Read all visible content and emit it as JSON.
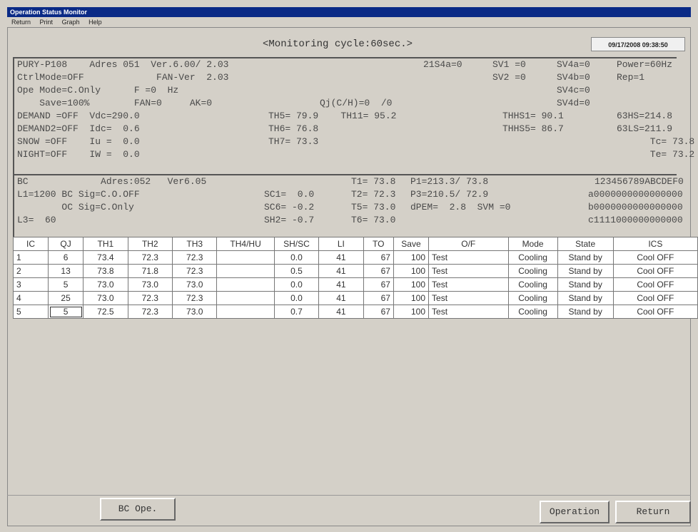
{
  "window": {
    "title": "Operation Status Monitor"
  },
  "menu": [
    "Return",
    "Print",
    "Graph",
    "Help"
  ],
  "header": {
    "cycle": "<Monitoring cycle:60sec.>",
    "datetime": "09/17/2008 09:38:50"
  },
  "outdoor": {
    "lines": [
      "PURY-P108    Adres 051  Ver.6.00/ 2.03",
      "CtrlMode=OFF             FAN-Ver  2.03",
      "Ope Mode=C.Only      F =0  Hz",
      "    Save=100%        FAN=0     AK=0",
      "DEMAND =OFF  Vdc=290.0",
      "DEMAND2=OFF  Idc=  0.6",
      "SNOW =OFF    Iu =  0.0",
      "NIGHT=OFF    IW =  0.0"
    ],
    "mid": [
      "",
      "",
      "",
      "Qj(C/H)=0  /0",
      "TH5= 79.9    TH11= 95.2",
      "TH6= 76.8",
      "TH7= 73.3",
      ""
    ],
    "right1": [
      "21S4a=0",
      "",
      "",
      "",
      "",
      "",
      "",
      ""
    ],
    "right2": [
      "SV1 =0",
      "SV2 =0",
      "",
      "",
      "THHS1= 90.1",
      "THHS5= 86.7",
      "",
      ""
    ],
    "right3": [
      "SV4a=0",
      "SV4b=0",
      "SV4c=0",
      "SV4d=0",
      "",
      "",
      "",
      ""
    ],
    "right4": [
      "Power=60Hz",
      "Rep=1",
      "",
      "",
      "63HS=214.8",
      "63LS=211.9",
      "      Tc= 73.8",
      "      Te= 73.2"
    ]
  },
  "bc": {
    "lines": [
      "BC             Adres:052   Ver6.05",
      "L1=1200 BC Sig=C.O.OFF",
      "        OC Sig=C.Only",
      "L3=  60"
    ],
    "sc": [
      "",
      "SC1=  0.0",
      "SC6= -0.2",
      "SH2= -0.7"
    ],
    "t": [
      "T1= 73.8",
      "T2= 72.3",
      "T5= 73.0",
      "T6= 73.0"
    ],
    "p": [
      "P1=213.3/ 73.8",
      "P3=210.5/ 72.9",
      "dPEM=  2.8  SVM =0",
      ""
    ],
    "hex": [
      "123456789ABCDEF0",
      "a0000000000000000",
      "b0000000000000000",
      "c1111000000000000"
    ]
  },
  "table": {
    "headers": [
      "IC",
      "QJ",
      "TH1",
      "TH2",
      "TH3",
      "TH4/HU",
      "SH/SC",
      "LI",
      "TO",
      "Save",
      "O/F",
      "Mode",
      "State",
      "ICS"
    ],
    "rows": [
      [
        "1",
        "6",
        "73.4",
        "72.3",
        "72.3",
        "",
        "0.0",
        "41",
        "67",
        "100",
        "Test",
        "Cooling",
        "Stand by",
        "Cool OFF"
      ],
      [
        "2",
        "13",
        "73.8",
        "71.8",
        "72.3",
        "",
        "0.5",
        "41",
        "67",
        "100",
        "Test",
        "Cooling",
        "Stand by",
        "Cool OFF"
      ],
      [
        "3",
        "5",
        "73.0",
        "73.0",
        "73.0",
        "",
        "0.0",
        "41",
        "67",
        "100",
        "Test",
        "Cooling",
        "Stand by",
        "Cool OFF"
      ],
      [
        "4",
        "25",
        "73.0",
        "72.3",
        "72.3",
        "",
        "0.0",
        "41",
        "67",
        "100",
        "Test",
        "Cooling",
        "Stand by",
        "Cool OFF"
      ],
      [
        "5",
        "5",
        "72.5",
        "72.3",
        "73.0",
        "",
        "0.7",
        "41",
        "67",
        "100",
        "Test",
        "Cooling",
        "Stand by",
        "Cool OFF"
      ]
    ]
  },
  "buttons": {
    "bc_ope": "BC Ope.",
    "operation": "Operation",
    "return": "Return"
  }
}
